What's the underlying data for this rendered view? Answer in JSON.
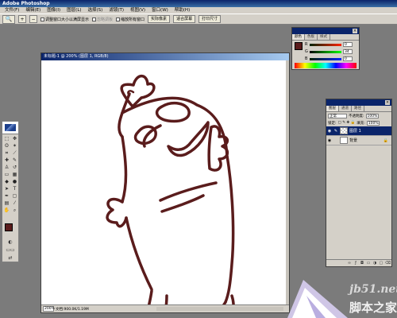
{
  "app": {
    "title": "Adobe Photoshop"
  },
  "menu": [
    "文件(F)",
    "编辑(E)",
    "图像(I)",
    "图层(L)",
    "选择(S)",
    "滤镜(T)",
    "视图(V)",
    "窗口(W)",
    "帮助(H)"
  ],
  "options": {
    "zoom_in": "+",
    "zoom_out": "−",
    "resize_windows": "调整窗口大小以满屏显示",
    "ignore_palettes": "忽略调板",
    "zoom_all_windows": "缩放所有窗口",
    "actual_pixels": "实际像素",
    "fit_on_screen": "适合屏幕",
    "print_size": "打印尺寸"
  },
  "document": {
    "title": "未标题-1 @ 200% (图层 1, RGB/8)",
    "zoom": "200%",
    "status": "文档:900.0K/1.19M"
  },
  "color_panel": {
    "tabs": [
      "颜色",
      "色板",
      "样式"
    ],
    "labels": [
      "R",
      "G",
      "B"
    ],
    "values": [
      "0",
      "34",
      "0"
    ],
    "accent": "#5a1c1c"
  },
  "layers_panel": {
    "tabs": [
      "图层",
      "通道",
      "路径"
    ],
    "blend_mode": "正常",
    "opacity_label": "不透明度:",
    "opacity": "100%",
    "lock_label": "锁定:",
    "fill_label": "填充:",
    "fill": "100%",
    "layers": [
      {
        "name": "图层 1",
        "selected": true
      },
      {
        "name": "背景",
        "selected": false
      }
    ]
  },
  "watermark": {
    "url": "jb51.net",
    "name": "脚本之家"
  }
}
